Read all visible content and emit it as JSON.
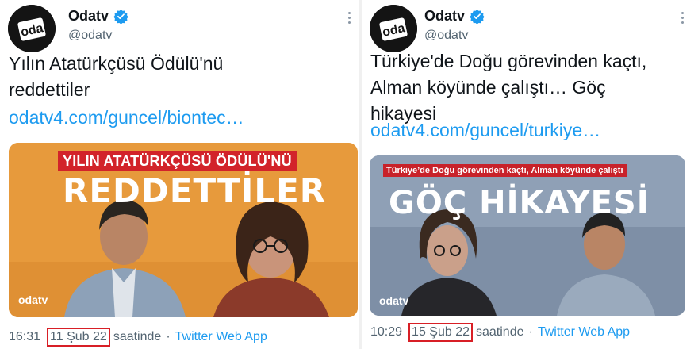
{
  "tweets": [
    {
      "author": {
        "name": "Odatv",
        "handle": "@odatv",
        "verified": true
      },
      "text_lines": [
        "Yılın Atatürkçüsü Ödülü'nü",
        "reddettiler"
      ],
      "link": "odatv4.com/guncel/biontec…",
      "card": {
        "overtitle": "YILIN ATATÜRKÇÜSÜ ÖDÜLÜ'NÜ",
        "headline": "REDDETTİLER",
        "brand": "odatv",
        "accent": "#e79a3c"
      },
      "meta": {
        "time": "16:31",
        "date": "11 Şub 22",
        "suffix": "saatinde",
        "separator": "·",
        "app": "Twitter Web App"
      }
    },
    {
      "author": {
        "name": "Odatv",
        "handle": "@odatv",
        "verified": true
      },
      "text_lines": [
        "Türkiye'de Doğu görevinden kaçtı,",
        "Alman köyünde çalıştı… Göç",
        "hikayesi"
      ],
      "link": "odatv4.com/guncel/turkiye…",
      "card": {
        "overtitle": "Türkiye’de Doğu görevinden kaçtı, Alman köyünde çalıştı",
        "headline": "GÖÇ HİKAYESİ",
        "brand": "odatv",
        "accent": "#7e8fa6"
      },
      "meta": {
        "time": "10:29",
        "date": "15 Şub 22",
        "suffix": "saatinde",
        "separator": "·",
        "app": "Twitter Web App"
      }
    }
  ],
  "colors": {
    "link": "#1d9bf0",
    "verified": "#1d9bf0",
    "highlight_box": "#d81f26",
    "secondary_text": "#536471"
  },
  "icons": {
    "verified": "verified-badge-icon",
    "more": "more-options-icon"
  }
}
